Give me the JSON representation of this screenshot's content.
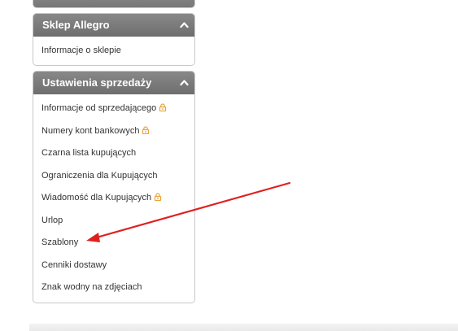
{
  "panels": {
    "sklep": {
      "title": "Sklep Allegro",
      "items": [
        {
          "label": "Informacje o sklepie",
          "locked": false
        }
      ]
    },
    "ustawienia": {
      "title": "Ustawienia sprzedaży",
      "items": [
        {
          "label": "Informacje od sprzedającego",
          "locked": true
        },
        {
          "label": "Numery kont bankowych",
          "locked": true
        },
        {
          "label": "Czarna lista kupujących",
          "locked": false
        },
        {
          "label": "Ograniczenia dla Kupujących",
          "locked": false
        },
        {
          "label": "Wiadomość dla Kupujących",
          "locked": true
        },
        {
          "label": "Urlop",
          "locked": false
        },
        {
          "label": "Szablony",
          "locked": false
        },
        {
          "label": "Cenniki dostawy",
          "locked": false
        },
        {
          "label": "Znak wodny na zdjęciach",
          "locked": false
        }
      ]
    }
  },
  "colors": {
    "header_bg": "#777777",
    "lock": "#e8a33c",
    "arrow": "#e02020"
  },
  "icons": {
    "collapse": "chevron-up-icon",
    "lock": "lock-icon"
  }
}
